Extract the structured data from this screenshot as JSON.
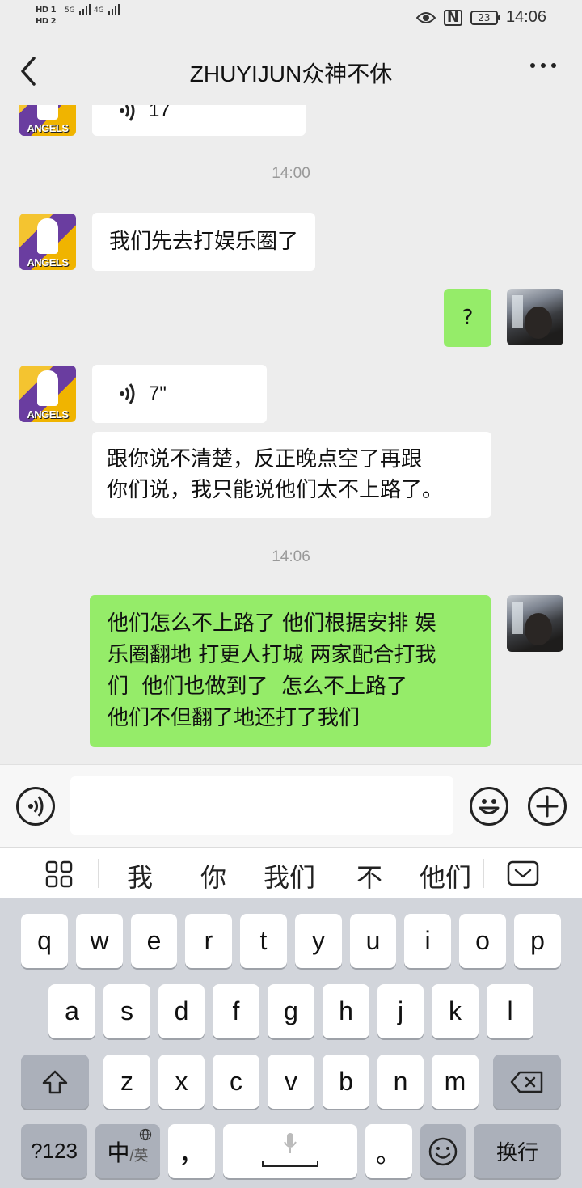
{
  "status_bar": {
    "hd1": "HD 1",
    "hd2": "HD 2",
    "net1": "5G",
    "net2": "4G",
    "nfc": "N",
    "battery": "23",
    "time": "14:06"
  },
  "header": {
    "title": "ZHUYIJUN众神不休"
  },
  "messages": {
    "partial_voice_duration": "17",
    "timestamp_1": "14:00",
    "msg_1": "我们先去打娱乐圈了",
    "msg_2": "?",
    "voice_duration": "7\"",
    "msg_3_line1": "跟你说不清楚，反正晚点空了再跟",
    "msg_3_line2": "你们说，我只能说他们太不上路了。",
    "timestamp_2": "14:06",
    "msg_4_line1": "他们怎么不上路了 他们根据安排 娱",
    "msg_4_line2": "乐圈翻地 打更人打城 两家配合打我",
    "msg_4_line3": "们  他们也做到了  怎么不上路了",
    "msg_4_line4": "他们不但翻了地还打了我们"
  },
  "avatar_text": "ANGELS",
  "candidates": [
    "我",
    "你",
    "我们",
    "不",
    "他们"
  ],
  "keyboard": {
    "row1": [
      "q",
      "w",
      "e",
      "r",
      "t",
      "y",
      "u",
      "i",
      "o",
      "p"
    ],
    "row2": [
      "a",
      "s",
      "d",
      "f",
      "g",
      "h",
      "j",
      "k",
      "l"
    ],
    "row3": [
      "z",
      "x",
      "c",
      "v",
      "b",
      "n",
      "m"
    ],
    "num_key": "?123",
    "lang_key_main": "中",
    "lang_key_sub": "/英",
    "comma_key": "，",
    "period_key": "。",
    "enter_key": "换行"
  },
  "colors": {
    "outgoing_bubble": "#95ec69",
    "incoming_bubble": "#ffffff",
    "chat_background": "#ededed"
  }
}
